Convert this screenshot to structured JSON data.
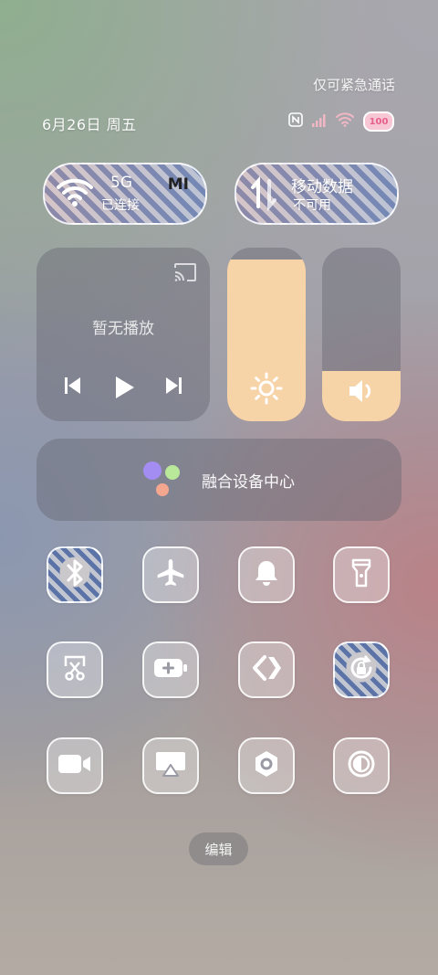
{
  "status": {
    "emergency": "仅可紧急通话",
    "date": "6月26日 周五",
    "battery": "100"
  },
  "wifi": {
    "band": "5G",
    "state": "已连接",
    "network": "MI"
  },
  "mobile_data": {
    "label": "移动数据",
    "state": "不可用"
  },
  "media": {
    "empty": "暂无播放"
  },
  "brightness": {
    "level": 0.93
  },
  "volume": {
    "level": 0.29
  },
  "fusion": {
    "label": "融合设备中心"
  },
  "toggles": [
    "bluetooth-icon",
    "airplane-icon",
    "bell-icon",
    "flashlight-icon",
    "screenshot-icon",
    "battery-saver-icon",
    "link-icon",
    "rotation-lock-icon",
    "video-camera-icon",
    "screen-cast-icon",
    "settings-icon",
    "contrast-icon"
  ],
  "edit": {
    "label": "编辑"
  },
  "colors": {
    "accent_fill": "#f7d3a8",
    "panel": "#646470"
  }
}
